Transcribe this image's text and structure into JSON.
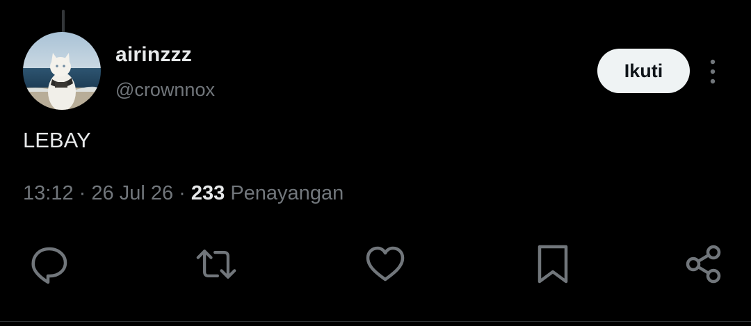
{
  "author": {
    "display_name": "airinzzz",
    "handle": "@crownnox"
  },
  "follow_button": {
    "label": "Ikuti"
  },
  "tweet": {
    "text": "LEBAY"
  },
  "meta": {
    "time": "13:12",
    "separator": "·",
    "date": "26 Jul 26",
    "views_count": "233",
    "views_label": "Penayangan"
  },
  "actions": [
    "reply-icon",
    "retweet-icon",
    "like-icon",
    "bookmark-icon",
    "share-icon"
  ],
  "colors": {
    "background": "#000000",
    "primary_text": "#e7e9ea",
    "secondary_text": "#71767b",
    "follow_button_bg": "#eff3f4",
    "follow_button_text": "#0f1419",
    "icon": "#71767b"
  }
}
